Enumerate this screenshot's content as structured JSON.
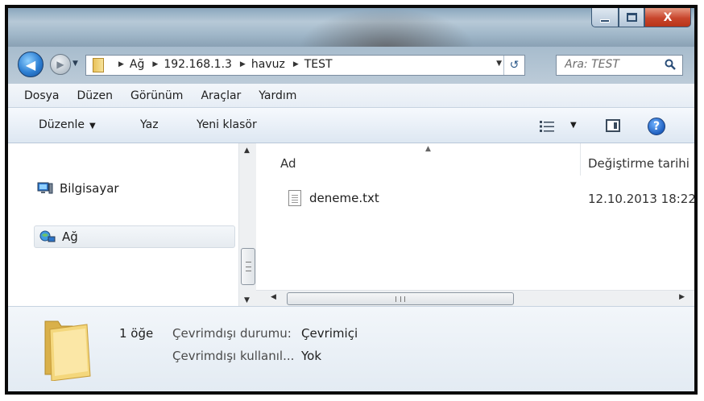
{
  "window": {
    "minimize_icon": "minimize-icon",
    "maximize_icon": "maximize-icon",
    "close_label": "X"
  },
  "nav": {
    "breadcrumbs": [
      "Ağ",
      "192.168.1.3",
      "havuz",
      "TEST"
    ],
    "search_placeholder": "Ara: TEST"
  },
  "menu": {
    "items": [
      "Dosya",
      "Düzen",
      "Görünüm",
      "Araçlar",
      "Yardım"
    ]
  },
  "commands": {
    "organize": "Düzenle",
    "share": "Yaz",
    "new_folder": "Yeni klasör",
    "help": "?"
  },
  "navpane": {
    "items": [
      {
        "label": "Bilgisayar",
        "icon": "computer-icon"
      },
      {
        "label": "Ağ",
        "icon": "network-icon",
        "selected": true
      }
    ]
  },
  "filelist": {
    "columns": {
      "name": "Ad",
      "modified": "Değiştirme tarihi"
    },
    "files": [
      {
        "name": "deneme.txt",
        "modified": "12.10.2013 18:22",
        "icon": "text-file-icon"
      }
    ]
  },
  "details": {
    "count": "1 öğe",
    "properties": [
      {
        "label": "Çevrimdışı durumu:",
        "value": "Çevrimiçi"
      },
      {
        "label": "Çevrimdışı kullanıl...",
        "value": "Yok"
      }
    ]
  },
  "colors": {
    "accent": "#1f5fbf",
    "frame": "#0a0a0a",
    "close": "#c8452c"
  }
}
